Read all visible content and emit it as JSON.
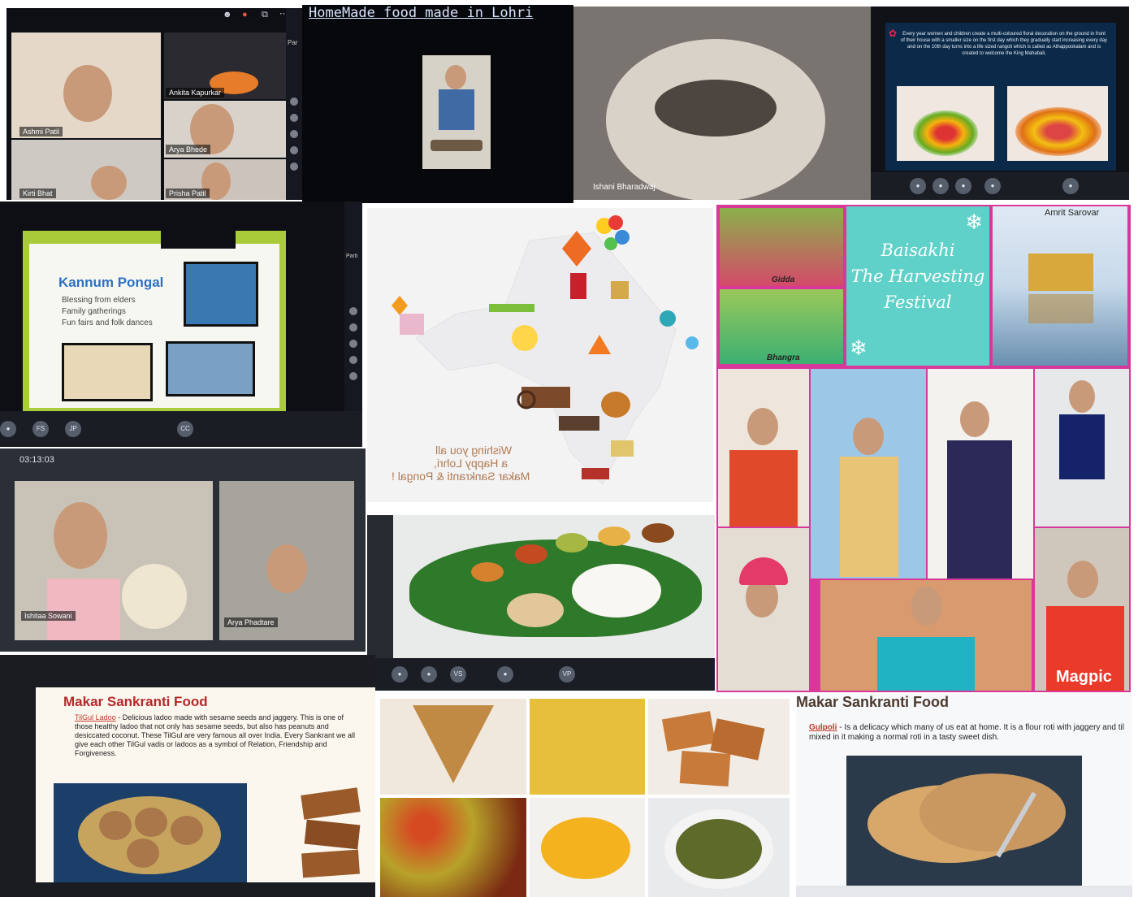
{
  "tiles": {
    "call1": {
      "names": [
        "Ashmi Patil",
        "Ankita Kapurkar",
        "Arya Bhede",
        "Kirti Bhat",
        "Prisha Patil"
      ],
      "panel_label": "Par"
    },
    "homemade": {
      "title": "HomeMade food made in Lohri"
    },
    "fish": {
      "name": "Ishani Bharadwaj"
    },
    "onam": {
      "text": "Every year women and children create a multi-coloured floral decoration on the ground in front of their house with a smaller size on the first day which they gradually start increasing every day and on the 10th day turns into a life sized rangoli which is called as Athappookalam and is created to welcome the King Mahabali."
    },
    "pongal": {
      "title": "Kannum Pongal",
      "bullets": [
        "Blessing from elders",
        "Family gatherings",
        "Fun fairs and folk dances"
      ],
      "toolbar": [
        "FS",
        "JP",
        "CC"
      ],
      "side_label": "Parti"
    },
    "greeting": {
      "lines": [
        "Wishing you all",
        "a Happy Lohri,",
        "Makar Sankranti & Pongal !"
      ]
    },
    "baisakhi": {
      "labels": [
        "Gidda",
        "Bhangra"
      ],
      "title_lines": [
        "Baisakhi",
        "The Harvesting",
        "Festival"
      ],
      "amrit": "Amrit Sarovar",
      "watermark": "Magpic"
    },
    "call2": {
      "timer": "03:13:03",
      "names": [
        "Ishitaa Sowani",
        "Arya Phadtare"
      ]
    },
    "thali": {
      "toolbar": [
        "VS",
        "VP"
      ]
    },
    "tilgul": {
      "heading": "Makar Sankranti Food",
      "item": "TilGul Ladoo",
      "desc": "- Delicious ladoo made with sesame seeds and jaggery. This is one of those healthy ladoo that not only has sesame seeds, but also has peanuts and desiccated coconut. These TilGul are very famous all over India. Every Sankrant we all give each other TilGul vadis or ladoos as a symbol of Relation, Friendship and Forgiveness."
    },
    "gulpoli": {
      "heading": "Makar Sankranti Food",
      "item": "Gulpoli",
      "desc": "- Is a delicacy which many of us eat at home. It is a flour roti with jaggery and til mixed in it making a normal roti in a tasty sweet dish."
    }
  },
  "colors": {
    "magenta": "#d8389a",
    "teal": "#5fd1c8",
    "lime": "#b9d33a",
    "heading_red": "#b5282a"
  }
}
